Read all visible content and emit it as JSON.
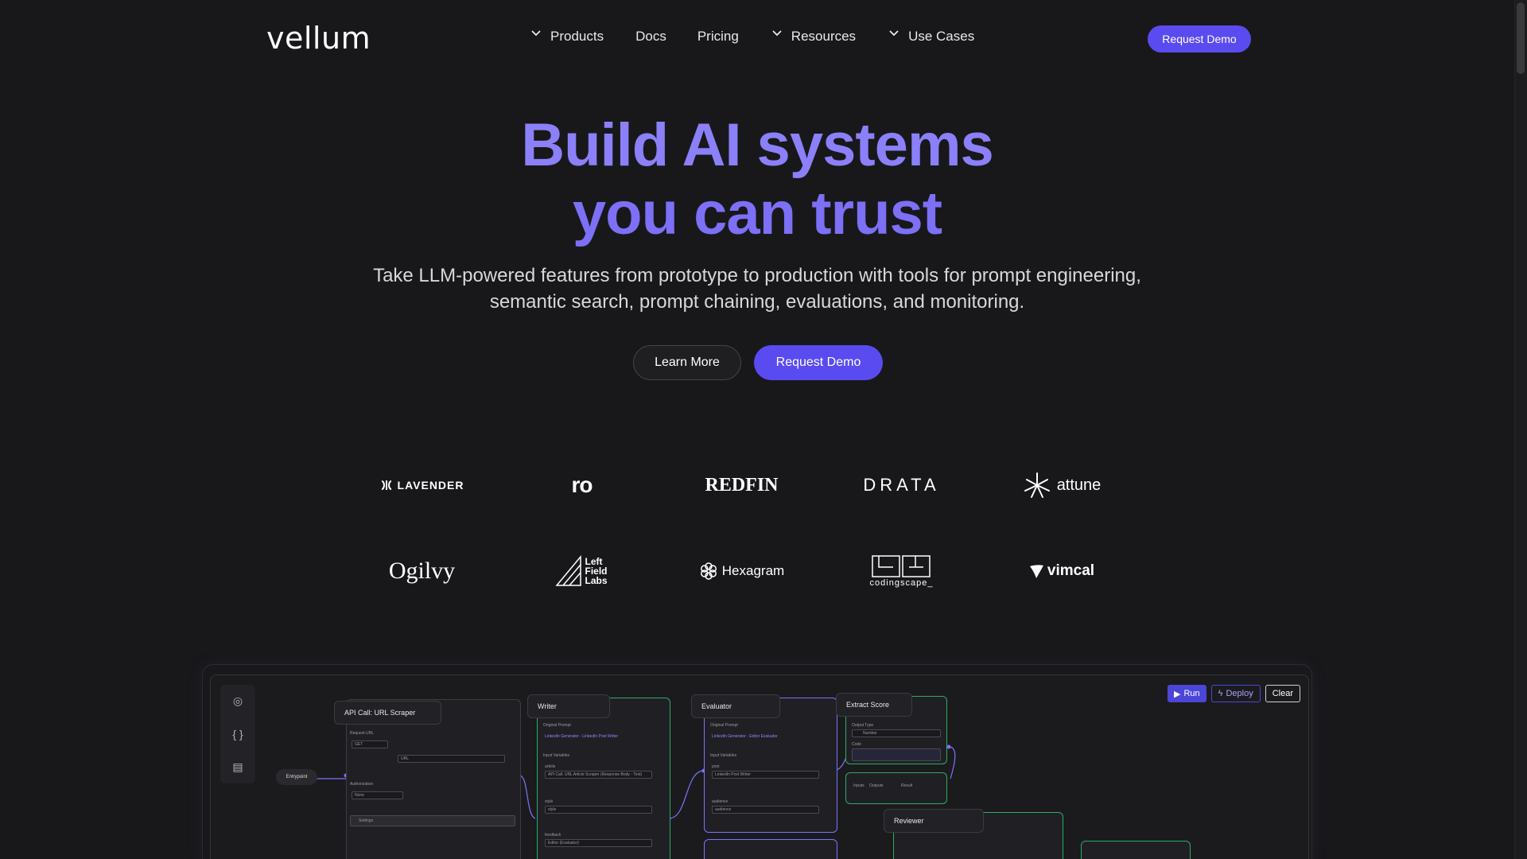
{
  "nav": {
    "logo": "vellum",
    "items": [
      {
        "label": "Products",
        "dropdown": true
      },
      {
        "label": "Docs",
        "dropdown": false
      },
      {
        "label": "Pricing",
        "dropdown": false
      },
      {
        "label": "Resources",
        "dropdown": true
      },
      {
        "label": "Use Cases",
        "dropdown": true
      }
    ],
    "cta": "Request Demo"
  },
  "hero": {
    "title_line1": "Build AI systems",
    "title_line2": "you can trust",
    "subtitle_line1": "Take LLM-powered features from prototype to production with tools for prompt engineering,",
    "subtitle_line2": "semantic search, prompt chaining, evaluations, and monitoring.",
    "learn_more": "Learn More",
    "request_demo": "Request Demo"
  },
  "customers": {
    "row1": [
      "LAVENDER",
      "ro",
      "REDFIN",
      "DRATA",
      "attune"
    ],
    "row2": [
      "Ogilvy",
      "Left Field Labs",
      "Hexagram",
      "codingscape_",
      "vimcal"
    ]
  },
  "preview": {
    "actions": {
      "run": "Run",
      "deploy": "Deploy",
      "clear": "Clear"
    },
    "nodes": {
      "entry": "Entrypoint",
      "api": "API Call: URL Scraper",
      "writer": "Writer",
      "evaluator": "Evaluator",
      "extract": "Extract Score",
      "reviewer": "Reviewer"
    },
    "labels": {
      "request_url": "Request URL",
      "get": "GET",
      "url": "URL",
      "authorization": "Authorization",
      "none": "None",
      "settings": "Settings",
      "original_prompt": "Original Prompt",
      "writer_prompt": "LinkedIn Generator - LinkedIn Post Writer",
      "evaluator_prompt": "LinkedIn Generator - Editor Evaluator",
      "input_variables": "Input Variables",
      "article": "article",
      "article_value": "API Call: URL Article Scraper (Response Body - Text)",
      "style": "style",
      "feedback": "feedback",
      "feedback_value": "Editor (Evaluator)",
      "post": "post",
      "post_value": "LinkedIn Post Writer",
      "audience": "audience",
      "output_type": "Output Type",
      "number": "Number",
      "code": "Code",
      "inputs": "Inputs",
      "outputs": "Outputs",
      "result": "Result",
      "json": "JSON"
    }
  },
  "colors": {
    "background": "#18181b",
    "accent": "#5a4bf0",
    "title": "#8b80f8",
    "node_green": "#2faa65",
    "node_purple": "#7b73ff"
  }
}
